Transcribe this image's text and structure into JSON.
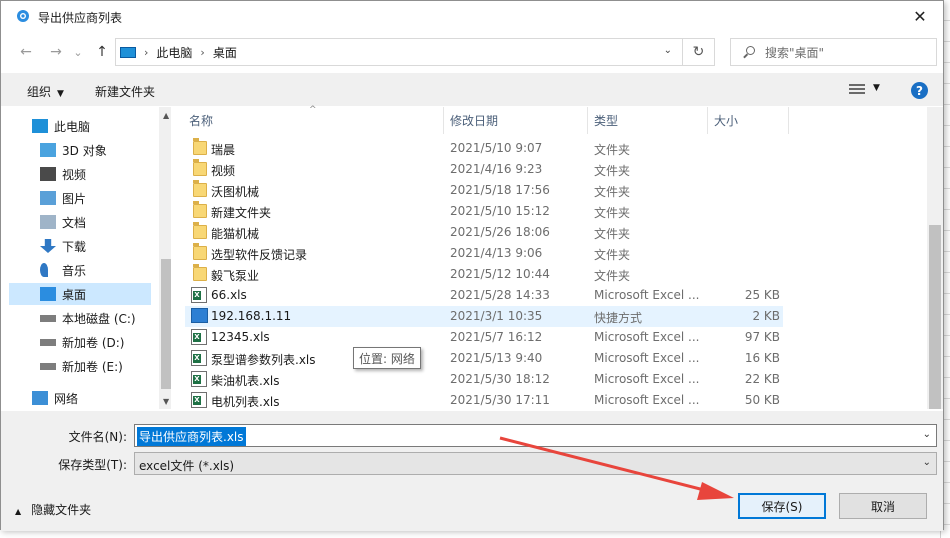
{
  "window": {
    "title": "导出供应商列表",
    "close_glyph": "✕"
  },
  "nav": {
    "back_glyph": "←",
    "forward_glyph": "→",
    "recent_glyph": "⌄",
    "up_glyph": "↑",
    "breadcrumb": [
      "此电脑",
      "桌面"
    ],
    "refresh_glyph": "↻",
    "search_placeholder": "搜索\"桌面\""
  },
  "toolbar": {
    "organize": "组织",
    "new_folder": "新建文件夹",
    "help": "?"
  },
  "navpane": {
    "items": [
      {
        "label": "此电脑",
        "icon": "computer-icon",
        "selected": false
      },
      {
        "label": "3D 对象",
        "icon": "3d-objects-icon",
        "selected": false
      },
      {
        "label": "视频",
        "icon": "video-icon",
        "selected": false
      },
      {
        "label": "图片",
        "icon": "pictures-icon",
        "selected": false
      },
      {
        "label": "文档",
        "icon": "documents-icon",
        "selected": false
      },
      {
        "label": "下载",
        "icon": "download-icon",
        "selected": false
      },
      {
        "label": "音乐",
        "icon": "music-icon",
        "selected": false
      },
      {
        "label": "桌面",
        "icon": "desktop-icon",
        "selected": true
      },
      {
        "label": "本地磁盘 (C:)",
        "icon": "drive-icon",
        "selected": false
      },
      {
        "label": "新加卷 (D:)",
        "icon": "drive-icon",
        "selected": false
      },
      {
        "label": "新加卷 (E:)",
        "icon": "drive-icon",
        "selected": false
      },
      {
        "label": "网络",
        "icon": "network-icon",
        "selected": false
      }
    ]
  },
  "columns": {
    "name": "名称",
    "date": "修改日期",
    "type": "类型",
    "size": "大小"
  },
  "files": [
    {
      "name": "瑞晨",
      "date": "2021/5/10 9:07",
      "type": "文件夹",
      "size": "",
      "icon": "folder-icon"
    },
    {
      "name": "视频",
      "date": "2021/4/16 9:23",
      "type": "文件夹",
      "size": "",
      "icon": "folder-icon"
    },
    {
      "name": "沃图机械",
      "date": "2021/5/18 17:56",
      "type": "文件夹",
      "size": "",
      "icon": "folder-icon"
    },
    {
      "name": "新建文件夹",
      "date": "2021/5/10 15:12",
      "type": "文件夹",
      "size": "",
      "icon": "folder-icon"
    },
    {
      "name": "能猫机械",
      "date": "2021/5/26 18:06",
      "type": "文件夹",
      "size": "",
      "icon": "folder-icon"
    },
    {
      "name": "选型软件反馈记录",
      "date": "2021/4/13 9:06",
      "type": "文件夹",
      "size": "",
      "icon": "folder-icon"
    },
    {
      "name": "毅飞泵业",
      "date": "2021/5/12 10:44",
      "type": "文件夹",
      "size": "",
      "icon": "folder-icon"
    },
    {
      "name": "66.xls",
      "date": "2021/5/28 14:33",
      "type": "Microsoft Excel ...",
      "size": "25 KB",
      "icon": "excel-icon"
    },
    {
      "name": "192.168.1.11",
      "date": "2021/3/1 10:35",
      "type": "快捷方式",
      "size": "2 KB",
      "icon": "shortcut-icon"
    },
    {
      "name": "12345.xls",
      "date": "2021/5/7 16:12",
      "type": "Microsoft Excel ...",
      "size": "97 KB",
      "icon": "excel-icon"
    },
    {
      "name": "泵型谱参数列表.xls",
      "date": "2021/5/13 9:40",
      "type": "Microsoft Excel ...",
      "size": "16 KB",
      "icon": "excel-icon"
    },
    {
      "name": "柴油机表.xls",
      "date": "2021/5/30 18:12",
      "type": "Microsoft Excel ...",
      "size": "22 KB",
      "icon": "excel-icon"
    },
    {
      "name": "电机列表.xls",
      "date": "2021/5/30 17:11",
      "type": "Microsoft Excel ...",
      "size": "50 KB",
      "icon": "excel-icon"
    }
  ],
  "tooltip": "位置: 网络",
  "form": {
    "filename_label": "文件名(N):",
    "filename_value": "导出供应商列表.xls",
    "filetype_label": "保存类型(T):",
    "filetype_value": "excel文件 (*.xls)",
    "hide_folders": "隐藏文件夹",
    "save_button": "保存(S)",
    "cancel_button": "取消"
  },
  "colors": {
    "accent": "#0078d7",
    "selection": "#cce8ff",
    "hover": "#e5f3ff",
    "annotation_arrow": "#e8453c"
  }
}
